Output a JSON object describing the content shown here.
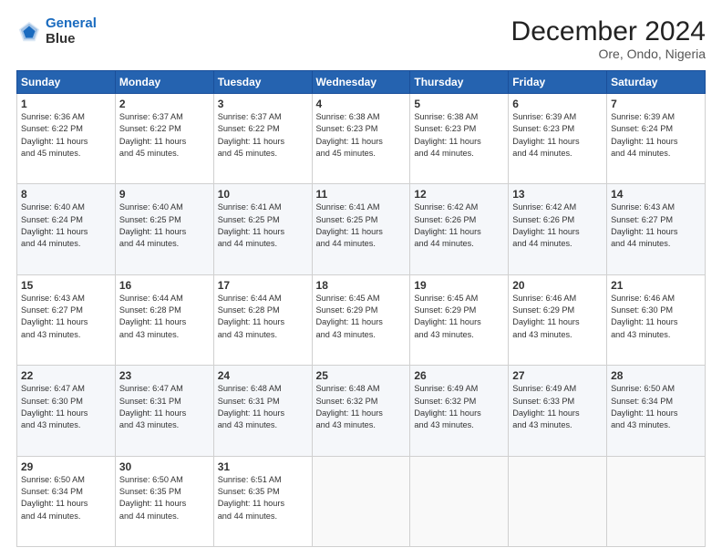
{
  "header": {
    "logo_line1": "General",
    "logo_line2": "Blue",
    "main_title": "December 2024",
    "subtitle": "Ore, Ondo, Nigeria"
  },
  "days_of_week": [
    "Sunday",
    "Monday",
    "Tuesday",
    "Wednesday",
    "Thursday",
    "Friday",
    "Saturday"
  ],
  "weeks": [
    [
      {
        "day": "1",
        "info": "Sunrise: 6:36 AM\nSunset: 6:22 PM\nDaylight: 11 hours\nand 45 minutes."
      },
      {
        "day": "2",
        "info": "Sunrise: 6:37 AM\nSunset: 6:22 PM\nDaylight: 11 hours\nand 45 minutes."
      },
      {
        "day": "3",
        "info": "Sunrise: 6:37 AM\nSunset: 6:22 PM\nDaylight: 11 hours\nand 45 minutes."
      },
      {
        "day": "4",
        "info": "Sunrise: 6:38 AM\nSunset: 6:23 PM\nDaylight: 11 hours\nand 45 minutes."
      },
      {
        "day": "5",
        "info": "Sunrise: 6:38 AM\nSunset: 6:23 PM\nDaylight: 11 hours\nand 44 minutes."
      },
      {
        "day": "6",
        "info": "Sunrise: 6:39 AM\nSunset: 6:23 PM\nDaylight: 11 hours\nand 44 minutes."
      },
      {
        "day": "7",
        "info": "Sunrise: 6:39 AM\nSunset: 6:24 PM\nDaylight: 11 hours\nand 44 minutes."
      }
    ],
    [
      {
        "day": "8",
        "info": "Sunrise: 6:40 AM\nSunset: 6:24 PM\nDaylight: 11 hours\nand 44 minutes."
      },
      {
        "day": "9",
        "info": "Sunrise: 6:40 AM\nSunset: 6:25 PM\nDaylight: 11 hours\nand 44 minutes."
      },
      {
        "day": "10",
        "info": "Sunrise: 6:41 AM\nSunset: 6:25 PM\nDaylight: 11 hours\nand 44 minutes."
      },
      {
        "day": "11",
        "info": "Sunrise: 6:41 AM\nSunset: 6:25 PM\nDaylight: 11 hours\nand 44 minutes."
      },
      {
        "day": "12",
        "info": "Sunrise: 6:42 AM\nSunset: 6:26 PM\nDaylight: 11 hours\nand 44 minutes."
      },
      {
        "day": "13",
        "info": "Sunrise: 6:42 AM\nSunset: 6:26 PM\nDaylight: 11 hours\nand 44 minutes."
      },
      {
        "day": "14",
        "info": "Sunrise: 6:43 AM\nSunset: 6:27 PM\nDaylight: 11 hours\nand 44 minutes."
      }
    ],
    [
      {
        "day": "15",
        "info": "Sunrise: 6:43 AM\nSunset: 6:27 PM\nDaylight: 11 hours\nand 43 minutes."
      },
      {
        "day": "16",
        "info": "Sunrise: 6:44 AM\nSunset: 6:28 PM\nDaylight: 11 hours\nand 43 minutes."
      },
      {
        "day": "17",
        "info": "Sunrise: 6:44 AM\nSunset: 6:28 PM\nDaylight: 11 hours\nand 43 minutes."
      },
      {
        "day": "18",
        "info": "Sunrise: 6:45 AM\nSunset: 6:29 PM\nDaylight: 11 hours\nand 43 minutes."
      },
      {
        "day": "19",
        "info": "Sunrise: 6:45 AM\nSunset: 6:29 PM\nDaylight: 11 hours\nand 43 minutes."
      },
      {
        "day": "20",
        "info": "Sunrise: 6:46 AM\nSunset: 6:29 PM\nDaylight: 11 hours\nand 43 minutes."
      },
      {
        "day": "21",
        "info": "Sunrise: 6:46 AM\nSunset: 6:30 PM\nDaylight: 11 hours\nand 43 minutes."
      }
    ],
    [
      {
        "day": "22",
        "info": "Sunrise: 6:47 AM\nSunset: 6:30 PM\nDaylight: 11 hours\nand 43 minutes."
      },
      {
        "day": "23",
        "info": "Sunrise: 6:47 AM\nSunset: 6:31 PM\nDaylight: 11 hours\nand 43 minutes."
      },
      {
        "day": "24",
        "info": "Sunrise: 6:48 AM\nSunset: 6:31 PM\nDaylight: 11 hours\nand 43 minutes."
      },
      {
        "day": "25",
        "info": "Sunrise: 6:48 AM\nSunset: 6:32 PM\nDaylight: 11 hours\nand 43 minutes."
      },
      {
        "day": "26",
        "info": "Sunrise: 6:49 AM\nSunset: 6:32 PM\nDaylight: 11 hours\nand 43 minutes."
      },
      {
        "day": "27",
        "info": "Sunrise: 6:49 AM\nSunset: 6:33 PM\nDaylight: 11 hours\nand 43 minutes."
      },
      {
        "day": "28",
        "info": "Sunrise: 6:50 AM\nSunset: 6:34 PM\nDaylight: 11 hours\nand 43 minutes."
      }
    ],
    [
      {
        "day": "29",
        "info": "Sunrise: 6:50 AM\nSunset: 6:34 PM\nDaylight: 11 hours\nand 44 minutes."
      },
      {
        "day": "30",
        "info": "Sunrise: 6:50 AM\nSunset: 6:35 PM\nDaylight: 11 hours\nand 44 minutes."
      },
      {
        "day": "31",
        "info": "Sunrise: 6:51 AM\nSunset: 6:35 PM\nDaylight: 11 hours\nand 44 minutes."
      },
      {
        "day": "",
        "info": ""
      },
      {
        "day": "",
        "info": ""
      },
      {
        "day": "",
        "info": ""
      },
      {
        "day": "",
        "info": ""
      }
    ]
  ]
}
